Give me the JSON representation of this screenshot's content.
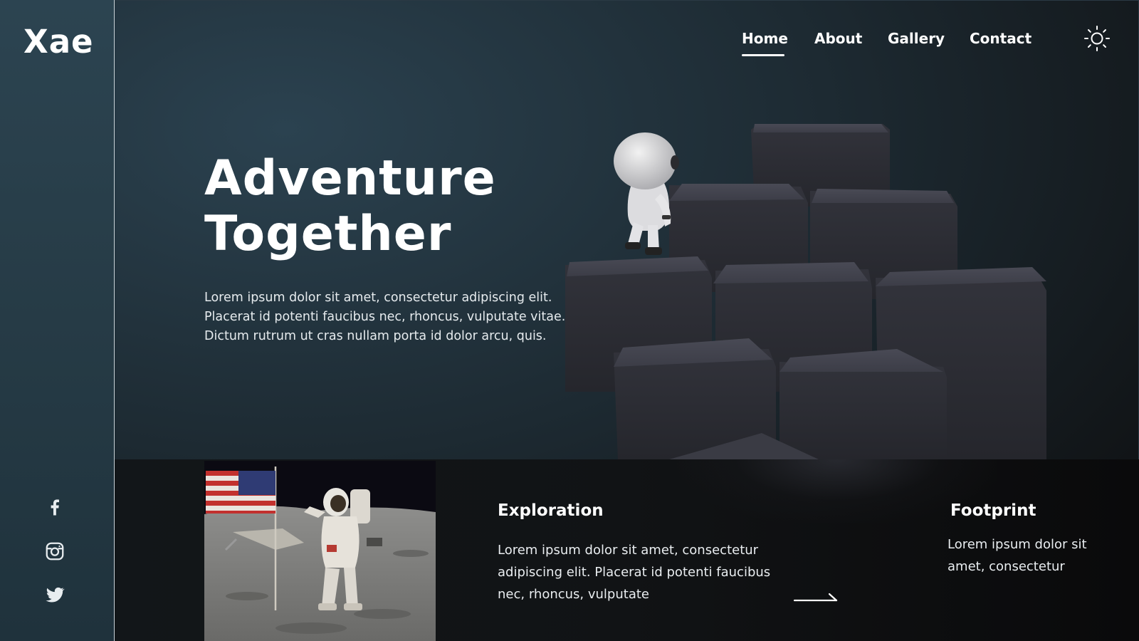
{
  "brand": {
    "logo": "Xae"
  },
  "nav": {
    "items": [
      {
        "label": "Home",
        "active": true
      },
      {
        "label": "About",
        "active": false
      },
      {
        "label": "Gallery",
        "active": false
      },
      {
        "label": "Contact",
        "active": false
      }
    ],
    "theme_icon": "sun-icon"
  },
  "hero": {
    "title_line1": "Adventure",
    "title_line2": "Together",
    "description_lines": [
      "Lorem ipsum dolor sit amet, consectetur adipiscing elit.",
      "Placerat id potenti faucibus nec, rhoncus, vulputate vitae.",
      "Dictum rutrum ut cras nullam porta id dolor arcu, quis."
    ]
  },
  "social": {
    "icons": [
      "facebook-icon",
      "instagram-icon",
      "twitter-icon"
    ]
  },
  "cards": {
    "exploration": {
      "title": "Exploration",
      "text_lines": [
        "Lorem ipsum dolor sit amet, consectetur",
        "adipiscing elit. Placerat id potenti faucibus",
        "nec, rhoncus, vulputate"
      ]
    },
    "footprint": {
      "title": "Footprint",
      "text_lines": [
        "Lorem ipsum dolor sit",
        "amet, consectetur"
      ]
    },
    "arrow_icon": "arrow-right-icon"
  },
  "colors": {
    "sidebar": "#2c4451",
    "background": "#1d2a32",
    "band": "#111315",
    "cube": "#34343d",
    "text": "#ffffff"
  }
}
